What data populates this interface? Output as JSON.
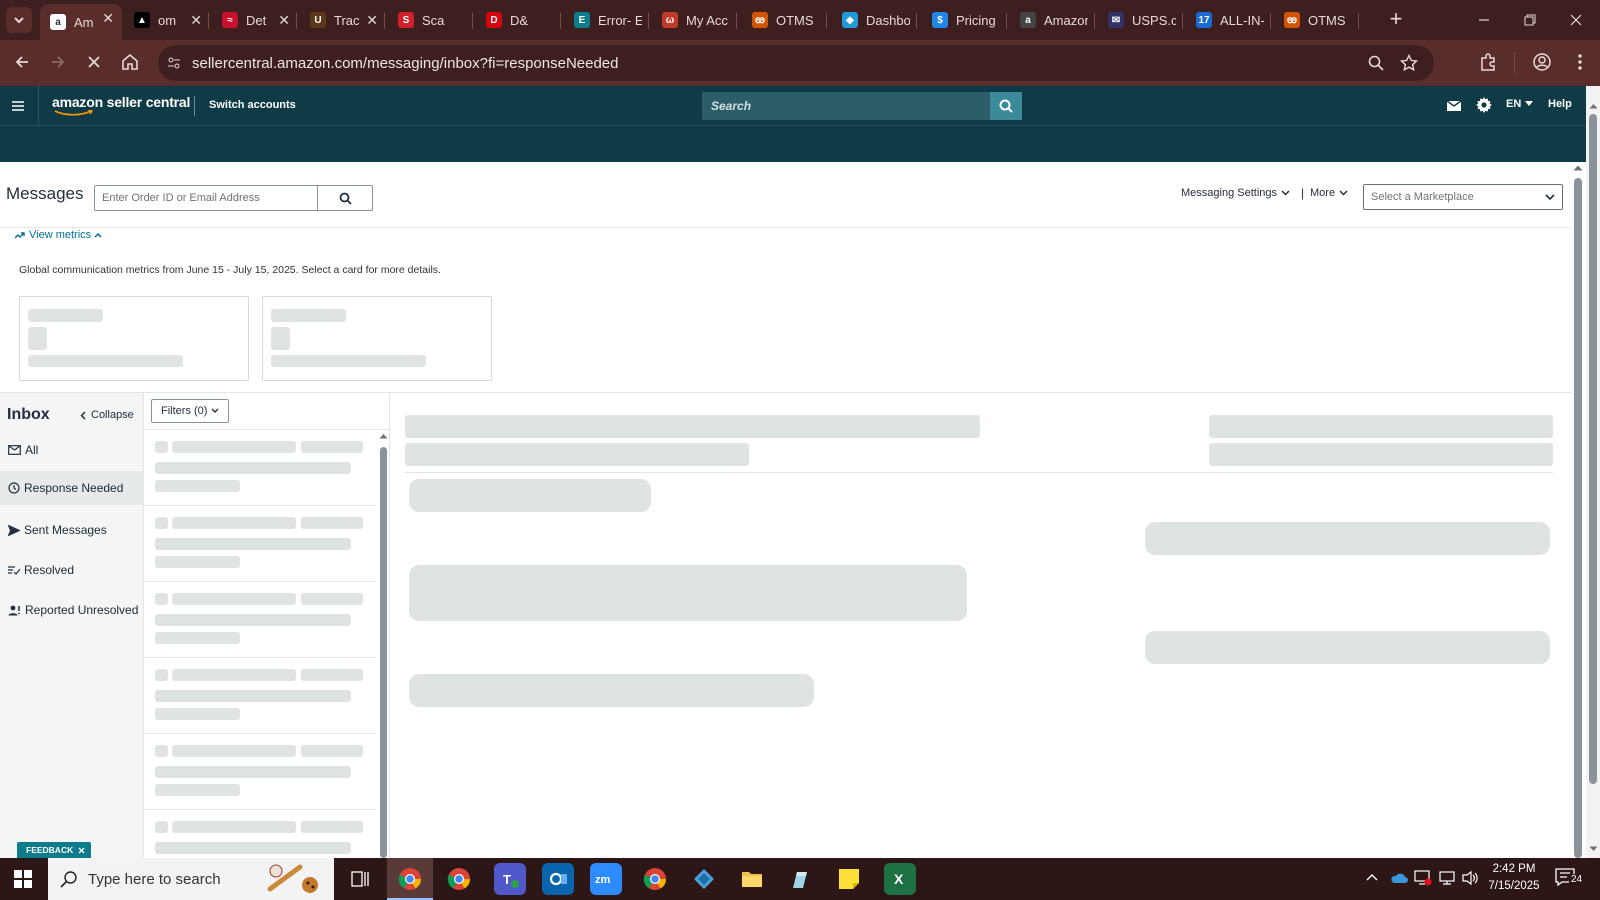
{
  "browser": {
    "tabs": [
      {
        "label": "Am",
        "icon": "amazon-icon",
        "color": "#ffffff",
        "active": true
      },
      {
        "label": "om",
        "icon": "triangle-icon",
        "color": "#000000"
      },
      {
        "label": "Det",
        "icon": "flag-icon",
        "color": "#c8102e"
      },
      {
        "label": "Trac",
        "icon": "ups-icon",
        "color": "#5b3a1b"
      },
      {
        "label": "Sca",
        "icon": "scan-icon",
        "color": "#d0202e"
      },
      {
        "label": "D&",
        "icon": "dh-icon",
        "color": "#d40511"
      },
      {
        "label": "Error- E",
        "icon": "eg-icon",
        "color": "#0a7c8a"
      },
      {
        "label": "My Acc",
        "icon": "wave-icon",
        "color": "#c0392b"
      },
      {
        "label": "OTMS",
        "icon": "otms-icon",
        "color": "#d35400"
      },
      {
        "label": "Dashbo",
        "icon": "diamond-icon",
        "color": "#1f9bd7"
      },
      {
        "label": "Pricing",
        "icon": "dollar-icon",
        "color": "#1e88e5"
      },
      {
        "label": "Amazon",
        "icon": "amazon-a-icon",
        "color": "#444444"
      },
      {
        "label": "USPS.co",
        "icon": "usps-icon",
        "color": "#333366"
      },
      {
        "label": "ALL-IN-",
        "icon": "seventeen-icon",
        "color": "#1a6bd1"
      },
      {
        "label": "OTMS",
        "icon": "otms-icon",
        "color": "#d35400"
      }
    ],
    "url": "sellercentral.amazon.com/messaging/inbox?fi=responseNeeded"
  },
  "header": {
    "logo": "amazon seller central",
    "switch_accounts": "Switch accounts",
    "search_placeholder": "Search",
    "lang": "EN",
    "help": "Help"
  },
  "messages": {
    "title": "Messages",
    "order_search_placeholder": "Enter Order ID or Email Address",
    "messaging_settings": "Messaging Settings",
    "more": "More",
    "separator": "|",
    "marketplace_placeholder": "Select a Marketplace"
  },
  "metrics": {
    "toggle": "View metrics",
    "description": "Global communication metrics from June 15 - July 15, 2025. Select a card for more details."
  },
  "inbox": {
    "title": "Inbox",
    "collapse": "Collapse",
    "filters": "Filters (0)",
    "nav": [
      {
        "label": "All",
        "icon": "mail-icon"
      },
      {
        "label": "Response Needed",
        "icon": "clock-icon",
        "selected": true
      },
      {
        "label": "Sent Messages",
        "icon": "send-icon"
      },
      {
        "label": "Resolved",
        "icon": "resolved-icon"
      },
      {
        "label": "Reported Unresolved",
        "icon": "person-alert-icon"
      }
    ]
  },
  "feedback": {
    "label": "FEEDBACK"
  },
  "taskbar": {
    "search_placeholder": "Type here to search",
    "time": "2:42 PM",
    "date": "7/15/2025",
    "notification_count": "24"
  }
}
